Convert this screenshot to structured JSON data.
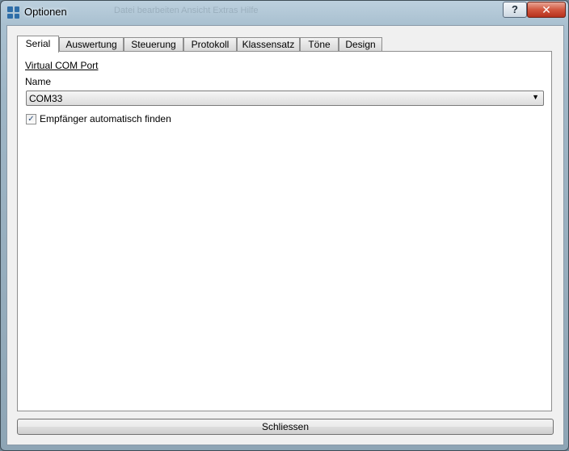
{
  "window": {
    "title": "Optionen",
    "help_label": "?",
    "close_label": "✕",
    "background_ghost_text": "Datei bearbeiten   Ansicht   Extras   Hilfe"
  },
  "tabs": [
    {
      "label": "Serial",
      "active": true
    },
    {
      "label": "Auswertung",
      "active": false
    },
    {
      "label": "Steuerung",
      "active": false
    },
    {
      "label": "Protokoll",
      "active": false
    },
    {
      "label": "Klassensatz",
      "active": false
    },
    {
      "label": "Töne",
      "active": false
    },
    {
      "label": "Design",
      "active": false
    }
  ],
  "serial": {
    "group_title": "Virtual COM Port",
    "name_label": "Name",
    "port_value": "COM33",
    "auto_find_checked": true,
    "auto_find_label": "Empfänger automatisch finden"
  },
  "footer": {
    "close_button_label": "Schliessen"
  },
  "icons": {
    "app": "app-grid-icon",
    "dropdown": "dropdown-arrow-icon",
    "checkmark": "checkmark-icon"
  },
  "colors": {
    "close_button_red": "#c9452e",
    "panel_background": "#ffffff",
    "dialog_background": "#f0f0f0"
  }
}
